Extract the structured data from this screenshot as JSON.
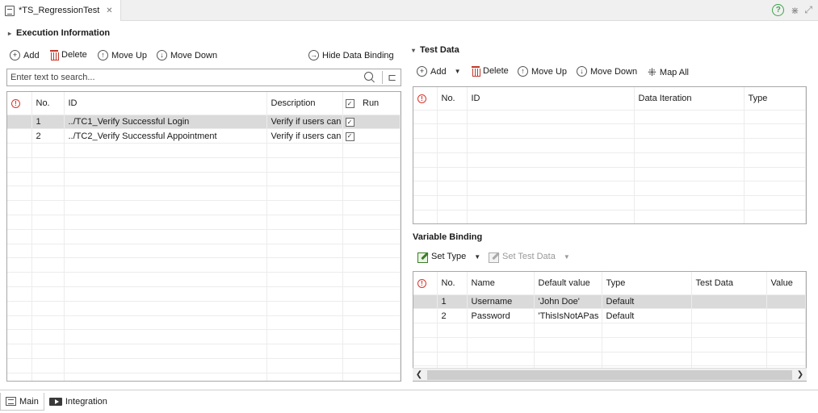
{
  "editor": {
    "tab_title": "*TS_RegressionTest",
    "close_glyph": "✕"
  },
  "execution": {
    "title": "Execution Information",
    "toolbar": {
      "add": "Add",
      "delete": "Delete",
      "move_up": "Move Up",
      "move_down": "Move Down",
      "hide_binding": "Hide Data Binding"
    },
    "search": {
      "placeholder": "Enter text to search..."
    },
    "columns": {
      "no": "No.",
      "id": "ID",
      "description": "Description",
      "run": "Run"
    },
    "rows": [
      {
        "no": "1",
        "id": "../TC1_Verify Successful Login",
        "description": "Verify if users can",
        "run": true
      },
      {
        "no": "2",
        "id": "../TC2_Verify Successful Appointment",
        "description": "Verify if users can",
        "run": true
      }
    ]
  },
  "test_data": {
    "title": "Test Data",
    "toolbar": {
      "add": "Add",
      "delete": "Delete",
      "move_up": "Move Up",
      "move_down": "Move Down",
      "map_all": "Map All"
    },
    "columns": {
      "no": "No.",
      "id": "ID",
      "iteration": "Data Iteration",
      "type": "Type"
    }
  },
  "variable_binding": {
    "title": "Variable Binding",
    "toolbar": {
      "set_type": "Set Type",
      "set_test_data": "Set Test Data"
    },
    "columns": {
      "no": "No.",
      "name": "Name",
      "default_value": "Default value",
      "type": "Type",
      "test_data": "Test Data",
      "value": "Value"
    },
    "rows": [
      {
        "no": "1",
        "name": "Username",
        "default_value": "'John Doe'",
        "type": "Default"
      },
      {
        "no": "2",
        "name": "Password",
        "default_value": "'ThisIsNotAPas",
        "type": "Default"
      }
    ]
  },
  "bottom_tabs": {
    "main": "Main",
    "integration": "Integration"
  },
  "colors": {
    "error": "#d9342b",
    "help": "#3fa34d",
    "delete": "#c0392b",
    "selected_row": "#dadada"
  }
}
